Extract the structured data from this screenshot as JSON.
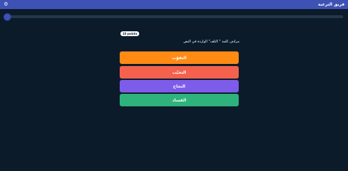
{
  "header": {
    "title": "فريق الترعية",
    "settings_icon": "gear-icon",
    "bar_color": "#3e52b5"
  },
  "progress": {
    "value_fraction": 0.01
  },
  "question": {
    "points_badge": "10 points",
    "text": "مرادف كلمة \" التلف\" الواردة في النص"
  },
  "options": [
    {
      "label": "التفوّب",
      "color": "#ff8a14"
    },
    {
      "label": "التخيّب",
      "color": "#f4614d"
    },
    {
      "label": "النجاح",
      "color": "#7d5cea"
    },
    {
      "label": "الفساد",
      "color": "#2eb37c"
    }
  ],
  "colors": {
    "background": "#0b1b2a"
  }
}
